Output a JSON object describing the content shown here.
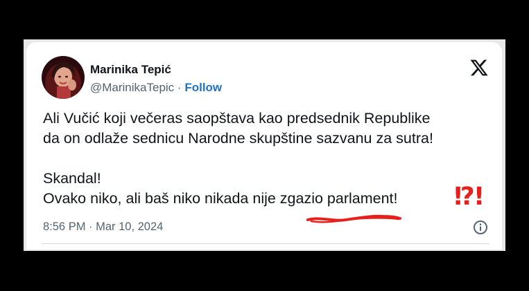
{
  "author": {
    "name": "Marinika Tepić",
    "handle": "@MarinikaTepic",
    "separator": "·",
    "follow_label": "Follow"
  },
  "icons": {
    "platform": "x-logo-icon",
    "info": "info-icon"
  },
  "tweet": {
    "paragraphs": [
      "Ali Vučić koji večeras saopštava kao predsednik Republike",
      "da on odlaže sednicu Narodne skupštine sazvanu za sutra!",
      "",
      "Skandal!",
      "Ovako niko, ali baš niko nikada nije zgazio parlament!"
    ],
    "emoji": "⁉!"
  },
  "meta": {
    "timestamp": "8:56 PM · Mar 10, 2024"
  },
  "colors": {
    "follow_link": "#1d73c9",
    "secondary_text": "#536471",
    "annotation_red": "#e5211e"
  }
}
